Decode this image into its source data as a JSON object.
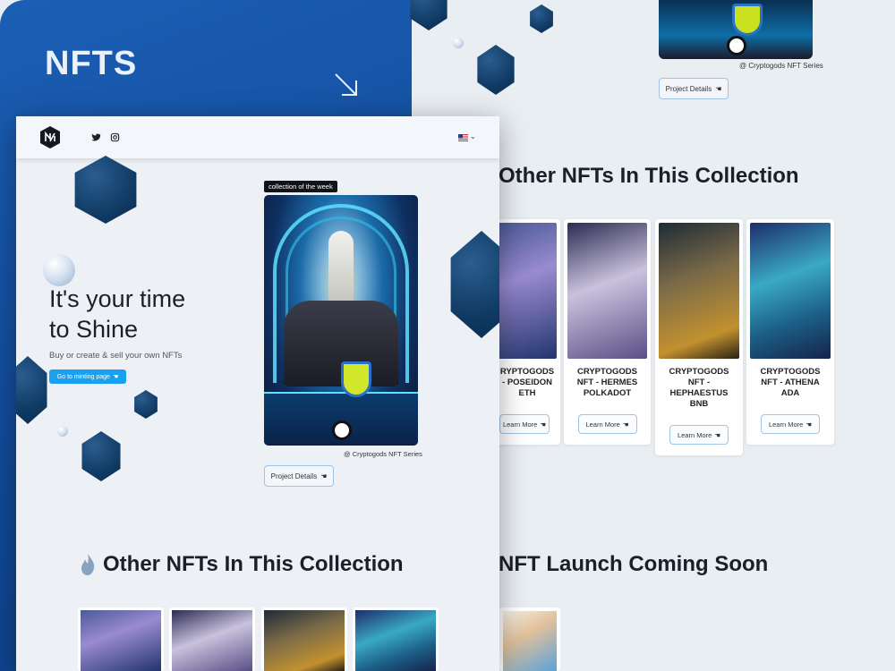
{
  "brand": {
    "title": "NFTS"
  },
  "background_page": {
    "top_caption": "@ Cryptogods NFT Series",
    "project_details_label": "Project Details",
    "other_heading": "Other NFTs In This Collection",
    "launch_heading": "NFT Launch Coming Soon",
    "cards": [
      {
        "title": "CRYPTOGODS NFT - POSEIDON ETH",
        "title_visible": "RYPTOGODS\n- POSEIDON\nETH",
        "button": "Learn More"
      },
      {
        "title": "CRYPTOGODS NFT - HERMES POLKADOT",
        "title_visible": "CRYPTOGODS\nNFT - HERMES\nPOLKADOT",
        "button": "Learn More"
      },
      {
        "title": "CRYPTOGODS NFT - HEPHAESTUS BNB",
        "title_visible": "CRYPTOGODS\nNFT -\nHEPHAESTUS\nBNB",
        "button": "Learn More"
      },
      {
        "title": "CRYPTOGODS NFT - ATHENA ADA",
        "title_visible": "CRYPTOGODS\nNFT - ATHENA\nADA",
        "button": "Learn More"
      }
    ]
  },
  "front_page": {
    "nav": {
      "language": "en-US",
      "social": [
        "twitter-icon",
        "instagram-icon"
      ]
    },
    "hero": {
      "headline_line1": "It's your time",
      "headline_line2": "to Shine",
      "subtitle": "Buy or create & sell your own NFTs",
      "cta_label": "Go to minting page"
    },
    "featured": {
      "tag": "collection of the week",
      "caption": "@ Cryptogods NFT Series",
      "details_label": "Project Details"
    },
    "other_heading": "Other NFTs In This Collection"
  },
  "colors": {
    "brand_blue": "#1557ad",
    "cta_blue": "#1aa0f0",
    "heading": "#1b1f2a"
  }
}
